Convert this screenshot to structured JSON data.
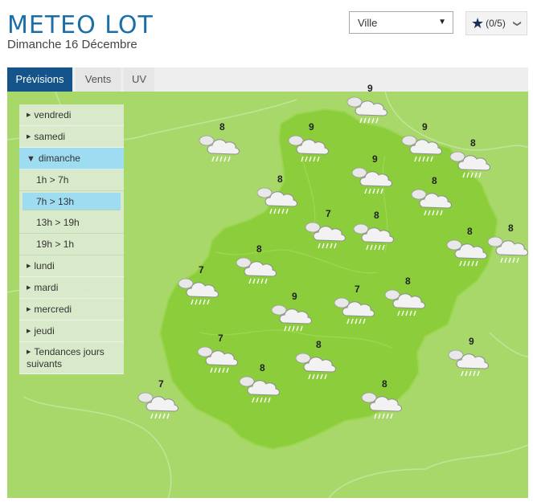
{
  "header": {
    "title": "METEO LOT",
    "date": "Dimanche 16 Décembre"
  },
  "city_select": {
    "value": "Ville",
    "caret": "▼"
  },
  "favorites": {
    "label": "(0/5)",
    "star": "★",
    "chev": "❯"
  },
  "tabs": [
    {
      "label": "Prévisions",
      "active": true
    },
    {
      "label": "Vents",
      "active": false
    },
    {
      "label": "UV",
      "active": false
    }
  ],
  "day_menu": {
    "days_before": [
      "vendredi",
      "samedi"
    ],
    "active_day": "dimanche",
    "slots": [
      "1h > 7h",
      "7h > 13h",
      "13h > 19h",
      "19h > 1h"
    ],
    "active_slot": "7h > 13h",
    "days_after": [
      "lundi",
      "mardi",
      "mercredi",
      "jeudi"
    ],
    "trend": "Tendances jours suivants"
  },
  "colors": {
    "map_bg": "#a9d86a",
    "lot_region": "#8ccd3c",
    "tab_active": "#14548a",
    "menu_active": "#9edcf2"
  },
  "forecast_icon": "rain-cloud-icon",
  "forecasts": [
    {
      "temp": "9"
    },
    {
      "temp": "8"
    },
    {
      "temp": "9"
    },
    {
      "temp": "9"
    },
    {
      "temp": "8"
    },
    {
      "temp": "9"
    },
    {
      "temp": "8"
    },
    {
      "temp": "8"
    },
    {
      "temp": "7"
    },
    {
      "temp": "8"
    },
    {
      "temp": "8"
    },
    {
      "temp": "8"
    },
    {
      "temp": "8"
    },
    {
      "temp": "7"
    },
    {
      "temp": "9"
    },
    {
      "temp": "7"
    },
    {
      "temp": "8"
    },
    {
      "temp": "7"
    },
    {
      "temp": "8"
    },
    {
      "temp": "9"
    },
    {
      "temp": "8"
    },
    {
      "temp": "7"
    },
    {
      "temp": "8"
    }
  ]
}
